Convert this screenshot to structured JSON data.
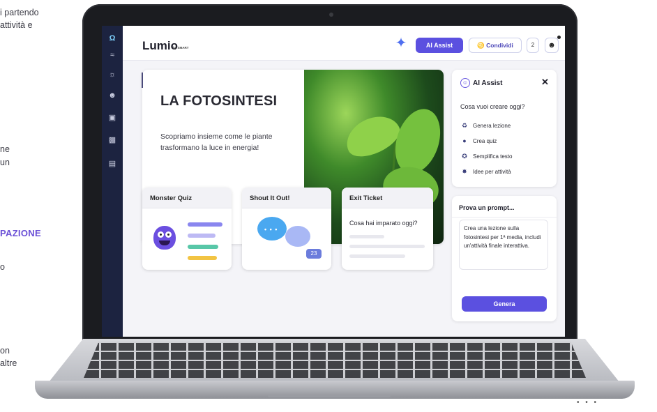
{
  "background_text": {
    "line1": "i partendo",
    "line2": "attività e",
    "line3": "ne",
    "line4": "un",
    "heading": "PAZIONE",
    "line5": "o",
    "line6": "on",
    "line7": "altre"
  },
  "app": {
    "logo": {
      "name": "Lumio",
      "sub": "by SMART"
    },
    "topbar": {
      "ai_assist_label": "AI Assist",
      "share_label": "Condividi",
      "count_label": "2"
    },
    "rail_icons": [
      "logo-icon",
      "chart-icon",
      "cloud-icon",
      "people-icon",
      "lesson-icon",
      "image-icon",
      "folder-icon"
    ]
  },
  "slide": {
    "title": "LA FOTOSINTESI",
    "subtitle": "Scopriamo insieme come le piante trasformano la luce in energia!"
  },
  "cards": [
    {
      "title": "Monster Quiz"
    },
    {
      "title": "Shout It Out!",
      "count": "23"
    },
    {
      "title": "Exit Ticket",
      "question": "Cosa hai imparato oggi?"
    }
  ],
  "ai_panel": {
    "title": "AI Assist",
    "question": "Cosa vuoi creare oggi?",
    "options": [
      {
        "icon": "lesson-icon",
        "label": "Genera lezione"
      },
      {
        "icon": "quiz-icon",
        "label": "Crea quiz"
      },
      {
        "icon": "magic-icon",
        "label": "Semplifica testo"
      },
      {
        "icon": "idea-icon",
        "label": "Idee per attività"
      }
    ]
  },
  "prompt_panel": {
    "title": "Prova un prompt...",
    "prompt_text": "Crea una lezione sulla fotosintesi per 1ª media, includi un'attività finale interattiva.",
    "button_label": "Genera"
  },
  "colors": {
    "accent": "#5b50e0",
    "rail": "#1c2340",
    "heading": "#6a4fd6"
  }
}
